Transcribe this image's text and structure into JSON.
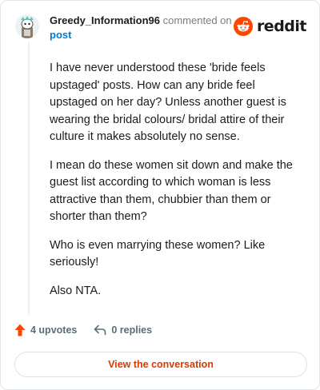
{
  "header": {
    "username": "Greedy_Information96",
    "commented_label": "commented on",
    "post_link": "post",
    "brand_name": "reddit",
    "avatar_icon": "snoo-avatar-icon",
    "brand_icon": "reddit-logo-icon"
  },
  "comment": {
    "paragraphs": [
      "I have never understood these 'bride feels upstaged' posts. How can any bride feel upstaged on her day? Unless another guest is wearing the bridal colours/ bridal attire of their culture it makes absolutely no sense.",
      "I mean do these women sit down and make the guest list according to which woman is less attractive than them, chubbier than them or shorter than them?",
      "Who is even marrying these women? Like seriously!",
      "Also NTA."
    ]
  },
  "actions": {
    "upvotes": "4 upvotes",
    "replies": "0 replies",
    "upvote_icon": "upvote-arrow-icon",
    "reply_icon": "reply-arrow-icon"
  },
  "footer": {
    "view_conversation": "View the conversation"
  },
  "colors": {
    "accent": "#d93a00",
    "link": "#0079d3",
    "upvote": "#ff4500",
    "muted": "#576f76"
  }
}
